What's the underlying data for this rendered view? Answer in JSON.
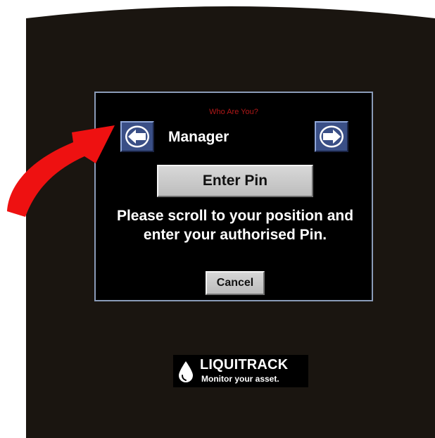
{
  "dialog": {
    "title": "Who Are You?",
    "position": "Manager",
    "enter_pin_label": "Enter Pin",
    "instructions": "Please scroll to your position and enter your authorised Pin.",
    "cancel_label": "Cancel"
  },
  "navigation": {
    "prev_icon": "arrow-left-icon",
    "next_icon": "arrow-right-icon"
  },
  "logo": {
    "name": "LIQUITRACK",
    "tagline": "Monitor your asset."
  },
  "colors": {
    "screen_background": "#1a1510",
    "dialog_background": "#000000",
    "dialog_border": "#8a9bb8",
    "title_text": "#b01818",
    "nav_button": "#3a4f86",
    "annotation_arrow": "#ee1111"
  }
}
